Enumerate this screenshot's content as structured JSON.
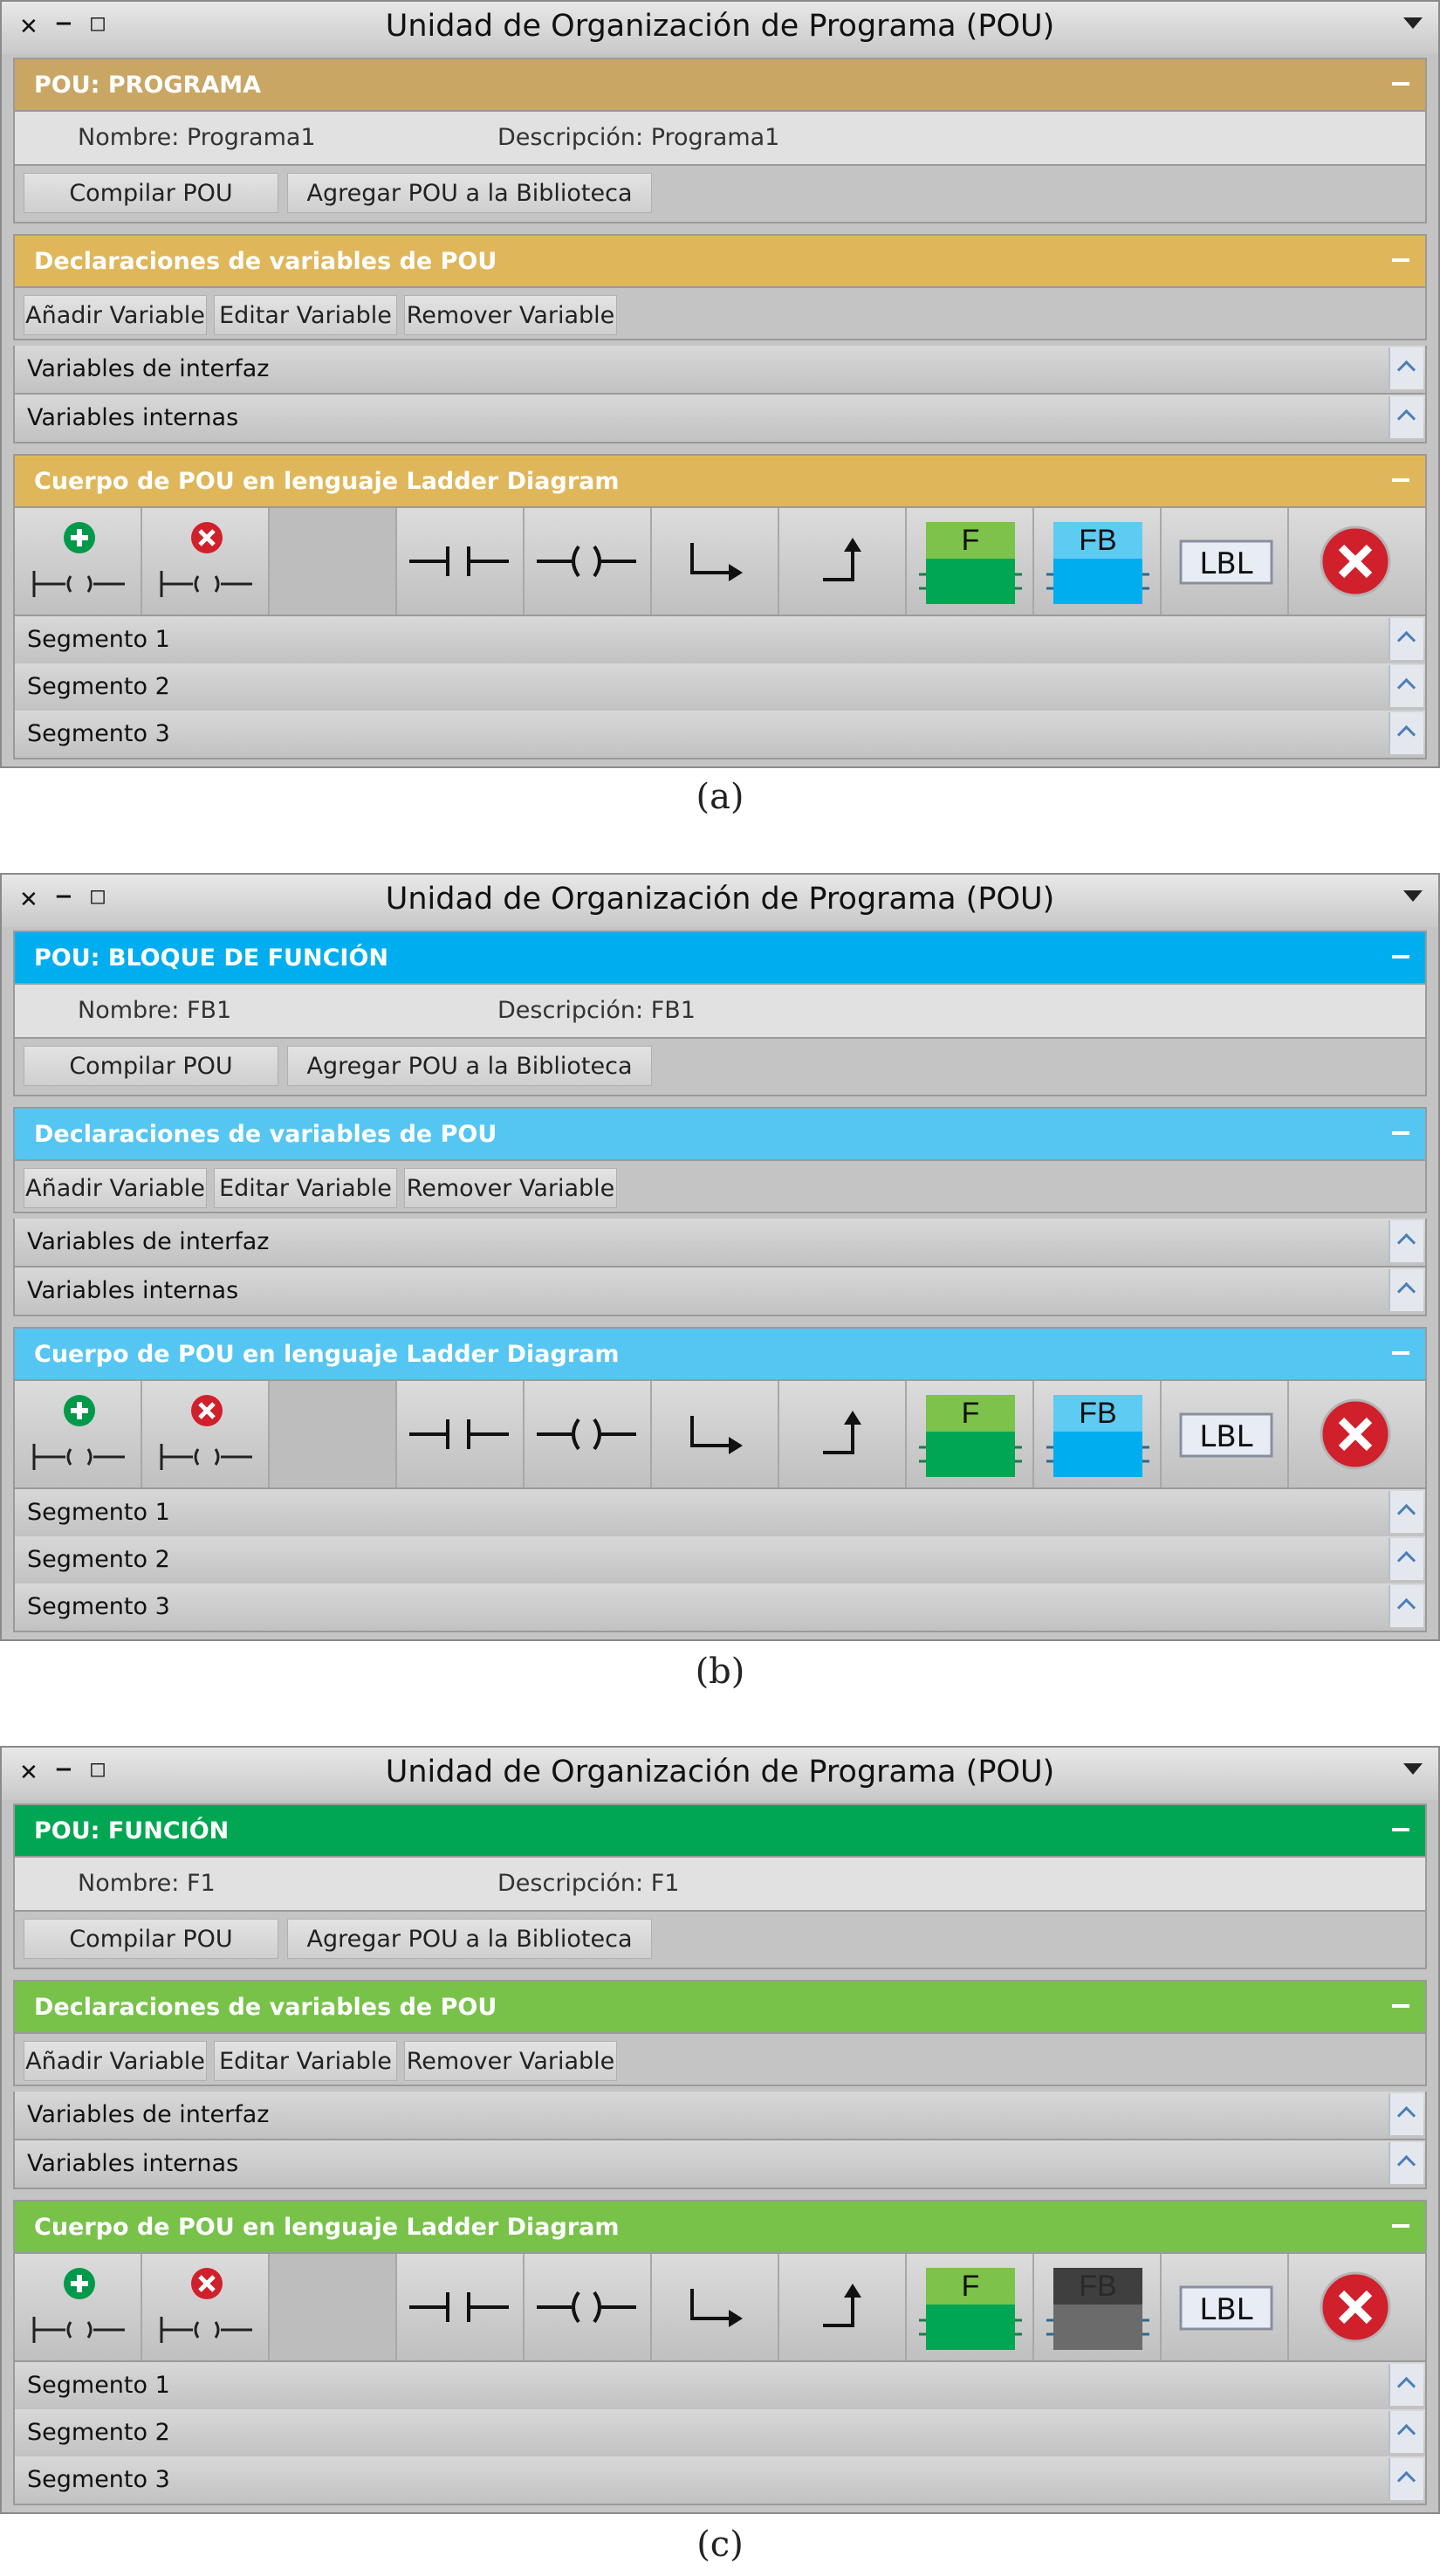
{
  "panels": [
    {
      "window_title": "Unidad de Organización de Programa (POU)",
      "pou_header": "POU: PROGRAMA",
      "name_text": "Nombre: Programa1",
      "desc_text": "Descripción: Programa1",
      "btn_compile": "Compilar POU",
      "btn_add_lib": "Agregar POU a la Biblioteca",
      "decl_header": "Declaraciones de variables de POU",
      "btn_add_var": "Añadir Variable",
      "btn_edit_var": "Editar Variable",
      "btn_remove_var": "Remover Variable",
      "interface_vars": "Variables de interfaz",
      "internal_vars": "Variables internas",
      "body_header": "Cuerpo de POU en lenguaje Ladder Diagram",
      "tool_f": "F",
      "tool_fb": "FB",
      "tool_lbl": "LBL",
      "segments": [
        "Segmento 1",
        "Segmento 2",
        "Segmento 3"
      ],
      "caption": "(a)",
      "colors": {
        "pou": "#c9a663",
        "decl": "#dfb75a",
        "body": "#dfb75a",
        "fb_box": "#00aeef",
        "fb_top": "#5ecbf2",
        "fb_state": "enabled"
      }
    },
    {
      "window_title": "Unidad de Organización de Programa (POU)",
      "pou_header": "POU: BLOQUE DE FUNCIÓN",
      "name_text": "Nombre: FB1",
      "desc_text": "Descripción: FB1",
      "btn_compile": "Compilar POU",
      "btn_add_lib": "Agregar POU a la Biblioteca",
      "decl_header": "Declaraciones de variables de POU",
      "btn_add_var": "Añadir Variable",
      "btn_edit_var": "Editar Variable",
      "btn_remove_var": "Remover Variable",
      "interface_vars": "Variables de interfaz",
      "internal_vars": "Variables internas",
      "body_header": "Cuerpo de POU en lenguaje Ladder Diagram",
      "tool_f": "F",
      "tool_fb": "FB",
      "tool_lbl": "LBL",
      "segments": [
        "Segmento 1",
        "Segmento 2",
        "Segmento 3"
      ],
      "caption": "(b)",
      "colors": {
        "pou": "#00adef",
        "decl": "#55c6f2",
        "body": "#55c6f2",
        "fb_box": "#00aeef",
        "fb_top": "#5ecbf2",
        "fb_state": "enabled"
      }
    },
    {
      "window_title": "Unidad de Organización de Programa (POU)",
      "pou_header": "POU: FUNCIÓN",
      "name_text": "Nombre: F1",
      "desc_text": "Descripción: F1",
      "btn_compile": "Compilar POU",
      "btn_add_lib": "Agregar POU a la Biblioteca",
      "decl_header": "Declaraciones de variables de POU",
      "btn_add_var": "Añadir Variable",
      "btn_edit_var": "Editar Variable",
      "btn_remove_var": "Remover Variable",
      "interface_vars": "Variables de interfaz",
      "internal_vars": "Variables internas",
      "body_header": "Cuerpo de POU en lenguaje Ladder Diagram",
      "tool_f": "F",
      "tool_fb": "FB",
      "tool_lbl": "LBL",
      "segments": [
        "Segmento 1",
        "Segmento 2",
        "Segmento 3"
      ],
      "caption": "(c)",
      "colors": {
        "pou": "#00a652",
        "decl": "#78c24a",
        "body": "#78c24a",
        "fb_box": "#6b6b6b",
        "fb_top": "#3f3f3f",
        "fb_state": "disabled"
      }
    }
  ],
  "icons": [
    "close-icon",
    "minimize-icon",
    "maximize-icon",
    "dropdown-icon",
    "collapse-icon",
    "add-segment-icon",
    "remove-segment-icon",
    "contact-icon",
    "coil-icon",
    "jump-icon",
    "return-icon",
    "function-block-f-icon",
    "function-block-fb-icon",
    "label-icon",
    "delete-icon",
    "scroll-up-icon"
  ]
}
